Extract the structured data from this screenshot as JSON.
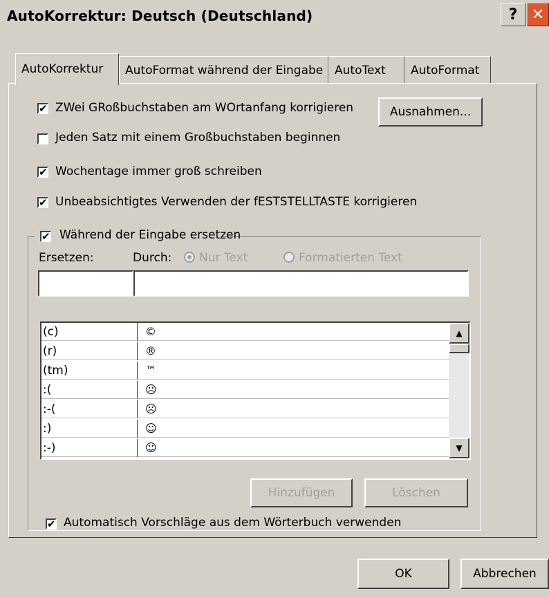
{
  "window": {
    "title": "AutoKorrektur: Deutsch (Deutschland)",
    "help_glyph": "?",
    "close_glyph": "✕"
  },
  "tabs": [
    {
      "label": "AutoKorrektur"
    },
    {
      "label": "AutoFormat während der Eingabe"
    },
    {
      "label": "AutoText"
    },
    {
      "label": "AutoFormat"
    }
  ],
  "options": {
    "two_caps": {
      "label": "ZWei GRoßbuchstaben am WOrtanfang korrigieren",
      "checked": true
    },
    "sentence_cap": {
      "label": "Jeden Satz mit einem Großbuchstaben beginnen",
      "checked": false
    },
    "weekdays": {
      "label": "Wochentage immer groß schreiben",
      "checked": true
    },
    "capslock": {
      "label": "Unbeabsichtigtes Verwenden der fESTSTELLTASTE korrigieren",
      "checked": true
    }
  },
  "exceptions_button": "Ausnahmen...",
  "replace_group": {
    "label": "Während der Eingabe ersetzen",
    "checked": true,
    "replace_label": "Ersetzen:",
    "with_label": "Durch:",
    "radio_plain": "Nur Text",
    "radio_formatted": "Formatierten Text",
    "replace_value": "",
    "with_value": ""
  },
  "entries": [
    {
      "from": "(c)",
      "to": "©"
    },
    {
      "from": "(r)",
      "to": "®"
    },
    {
      "from": "(tm)",
      "to": "™"
    },
    {
      "from": ":(",
      "to": "☹"
    },
    {
      "from": ":-(",
      "to": "☹"
    },
    {
      "from": ":)",
      "to": "☺"
    },
    {
      "from": ":-)",
      "to": "☺"
    }
  ],
  "buttons": {
    "add": "Hinzufügen",
    "delete": "Löschen",
    "ok": "OK",
    "cancel": "Abbrechen"
  },
  "suggestions": {
    "label": "Automatisch Vorschläge aus dem Wörterbuch verwenden",
    "checked": true
  },
  "check_glyph": "✔"
}
